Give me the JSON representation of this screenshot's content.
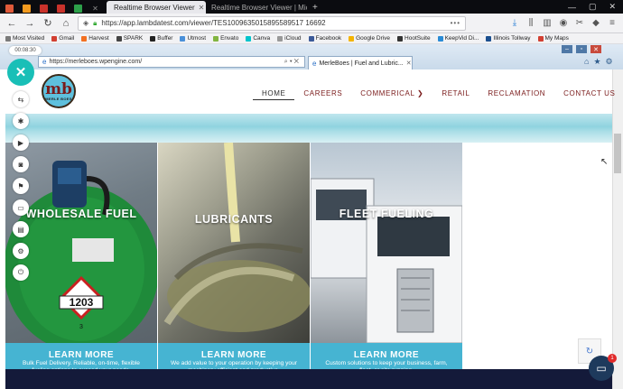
{
  "browser": {
    "pinned_tabs": [
      {
        "icon": "gmail-icon",
        "color": "#e05a3a"
      },
      {
        "icon": "b-icon",
        "color": "#f29a1f"
      },
      {
        "icon": "gmail-icon",
        "color": "#c9322b"
      },
      {
        "icon": "gmail-icon",
        "color": "#c9322b"
      },
      {
        "icon": "sheets-icon",
        "color": "#2da04a"
      },
      {
        "icon": "close-icon",
        "color": "#888"
      }
    ],
    "active_tab_title": "Realtime Browser Viewer",
    "inactive_tab_title": "Realtime Browser Viewer | Microsoft — Wi",
    "new_tab": "+",
    "window_controls": [
      "—",
      "▢",
      "✕"
    ],
    "url": "https://app.lambdatest.com/viewer/TES1009635015895589517 16692",
    "url_more": "•••"
  },
  "bookmarks": [
    {
      "label": "Most Visited",
      "color": "#7a7a7a"
    },
    {
      "label": "Gmail",
      "color": "#d23f31"
    },
    {
      "label": "Harvest",
      "color": "#f37021"
    },
    {
      "label": "SPARK",
      "color": "#444"
    },
    {
      "label": "Buffer",
      "color": "#222"
    },
    {
      "label": "Utmost",
      "color": "#4a90d9"
    },
    {
      "label": "Envato",
      "color": "#82b541"
    },
    {
      "label": "Canva",
      "color": "#00c4cc"
    },
    {
      "label": "iCloud",
      "color": "#999"
    },
    {
      "label": "Facebook",
      "color": "#3b5998"
    },
    {
      "label": "Google Drive",
      "color": "#f4b400"
    },
    {
      "label": "HootSuite",
      "color": "#333"
    },
    {
      "label": "KeepVid Di...",
      "color": "#2a8bd5"
    },
    {
      "label": "Illinois Tollway",
      "color": "#1b4f8f"
    },
    {
      "label": "My Maps",
      "color": "#d23f31"
    }
  ],
  "viewer": {
    "timer": "00:08:30",
    "inner_url": "https://merleboes.wpengine.com/",
    "inner_tab_title": "MerleBoes | Fuel and Lubric...",
    "inner_tab_close": "✕"
  },
  "site": {
    "logo_text": "mb",
    "logo_subtext": "MERLE BOES",
    "menu": [
      {
        "label": "HOME",
        "active": true
      },
      {
        "label": "CAREERS",
        "active": false
      },
      {
        "label": "COMMERICAL ❯",
        "active": false
      },
      {
        "label": "RETAIL",
        "active": false
      },
      {
        "label": "RECLAMATION",
        "active": false
      },
      {
        "label": "CONTACT US",
        "active": false
      }
    ],
    "cards": [
      {
        "title": "WHOLESALE FUEL",
        "button": "LEARN MORE",
        "desc": "Bulk Fuel Delivery. Reliable, on-time, flexible fueling options to exceed your needs."
      },
      {
        "title": "LUBRICANTS",
        "button": "LEARN MORE",
        "desc": "We add value to your operation by keeping your machinery efficient and productive."
      },
      {
        "title": "FLEET FUELING",
        "button": "LEARN MORE",
        "desc": "Custom solutions to keep your business, farm, fleet, or site running."
      }
    ],
    "chat_badge": "1"
  },
  "colors": {
    "teal_accent": "#19bfb7",
    "brand_red": "#7a1b1b",
    "card_blue": "#46b4d2",
    "footer_navy": "#141a3a"
  }
}
